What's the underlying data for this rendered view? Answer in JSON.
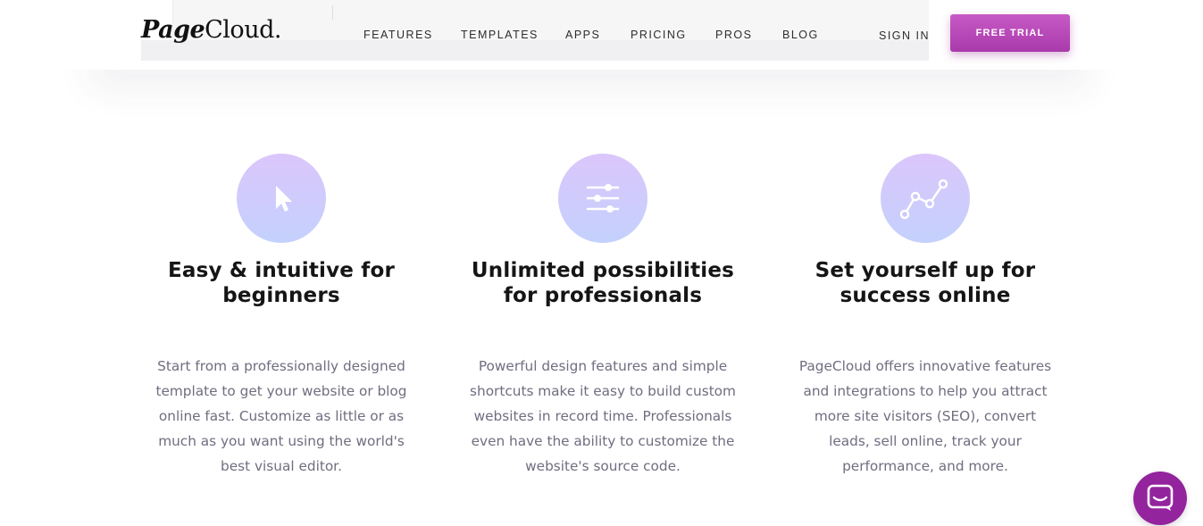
{
  "header": {
    "logo": {
      "part1": "Page",
      "part2": "Cloud."
    },
    "nav": [
      {
        "label": "FEATURES"
      },
      {
        "label": "TEMPLATES"
      },
      {
        "label": "APPS"
      },
      {
        "label": "PRICING"
      },
      {
        "label": "PROS"
      },
      {
        "label": "BLOG"
      }
    ],
    "sign_in": "SIGN IN",
    "cta": "FREE TRIAL"
  },
  "features": [
    {
      "icon": "cursor-arrow-icon",
      "title_lines": [
        "Easy & intuitive for",
        "beginners"
      ],
      "desc_lines": [
        "Start from a professionally designed",
        "template to get your website or blog",
        "online fast. Customize as little or as",
        "much as you want using the world's",
        "best visual editor."
      ]
    },
    {
      "icon": "sliders-icon",
      "title_lines": [
        "Unlimited possibilities",
        "for professionals"
      ],
      "desc_lines": [
        "Powerful design features and simple",
        "shortcuts make it easy to build custom",
        "websites in record time. Professionals",
        "even have the ability to customize the",
        "website's source code."
      ]
    },
    {
      "icon": "line-chart-icon",
      "title_lines": [
        "Set yourself up for",
        "success online"
      ],
      "desc_lines": [
        "PageCloud offers innovative features",
        "and integrations to help you attract",
        "more site visitors (SEO), convert",
        "leads, sell online, track your",
        "performance, and more."
      ]
    }
  ],
  "chat": {
    "icon": "chat-bubble-icon"
  },
  "colors": {
    "brand_purple": "#b447b6",
    "chat_purple": "#93249e",
    "icon_gradient_top": "#dbc6fb",
    "icon_gradient_bottom": "#c4d1fc",
    "body_text": "#716d80"
  }
}
